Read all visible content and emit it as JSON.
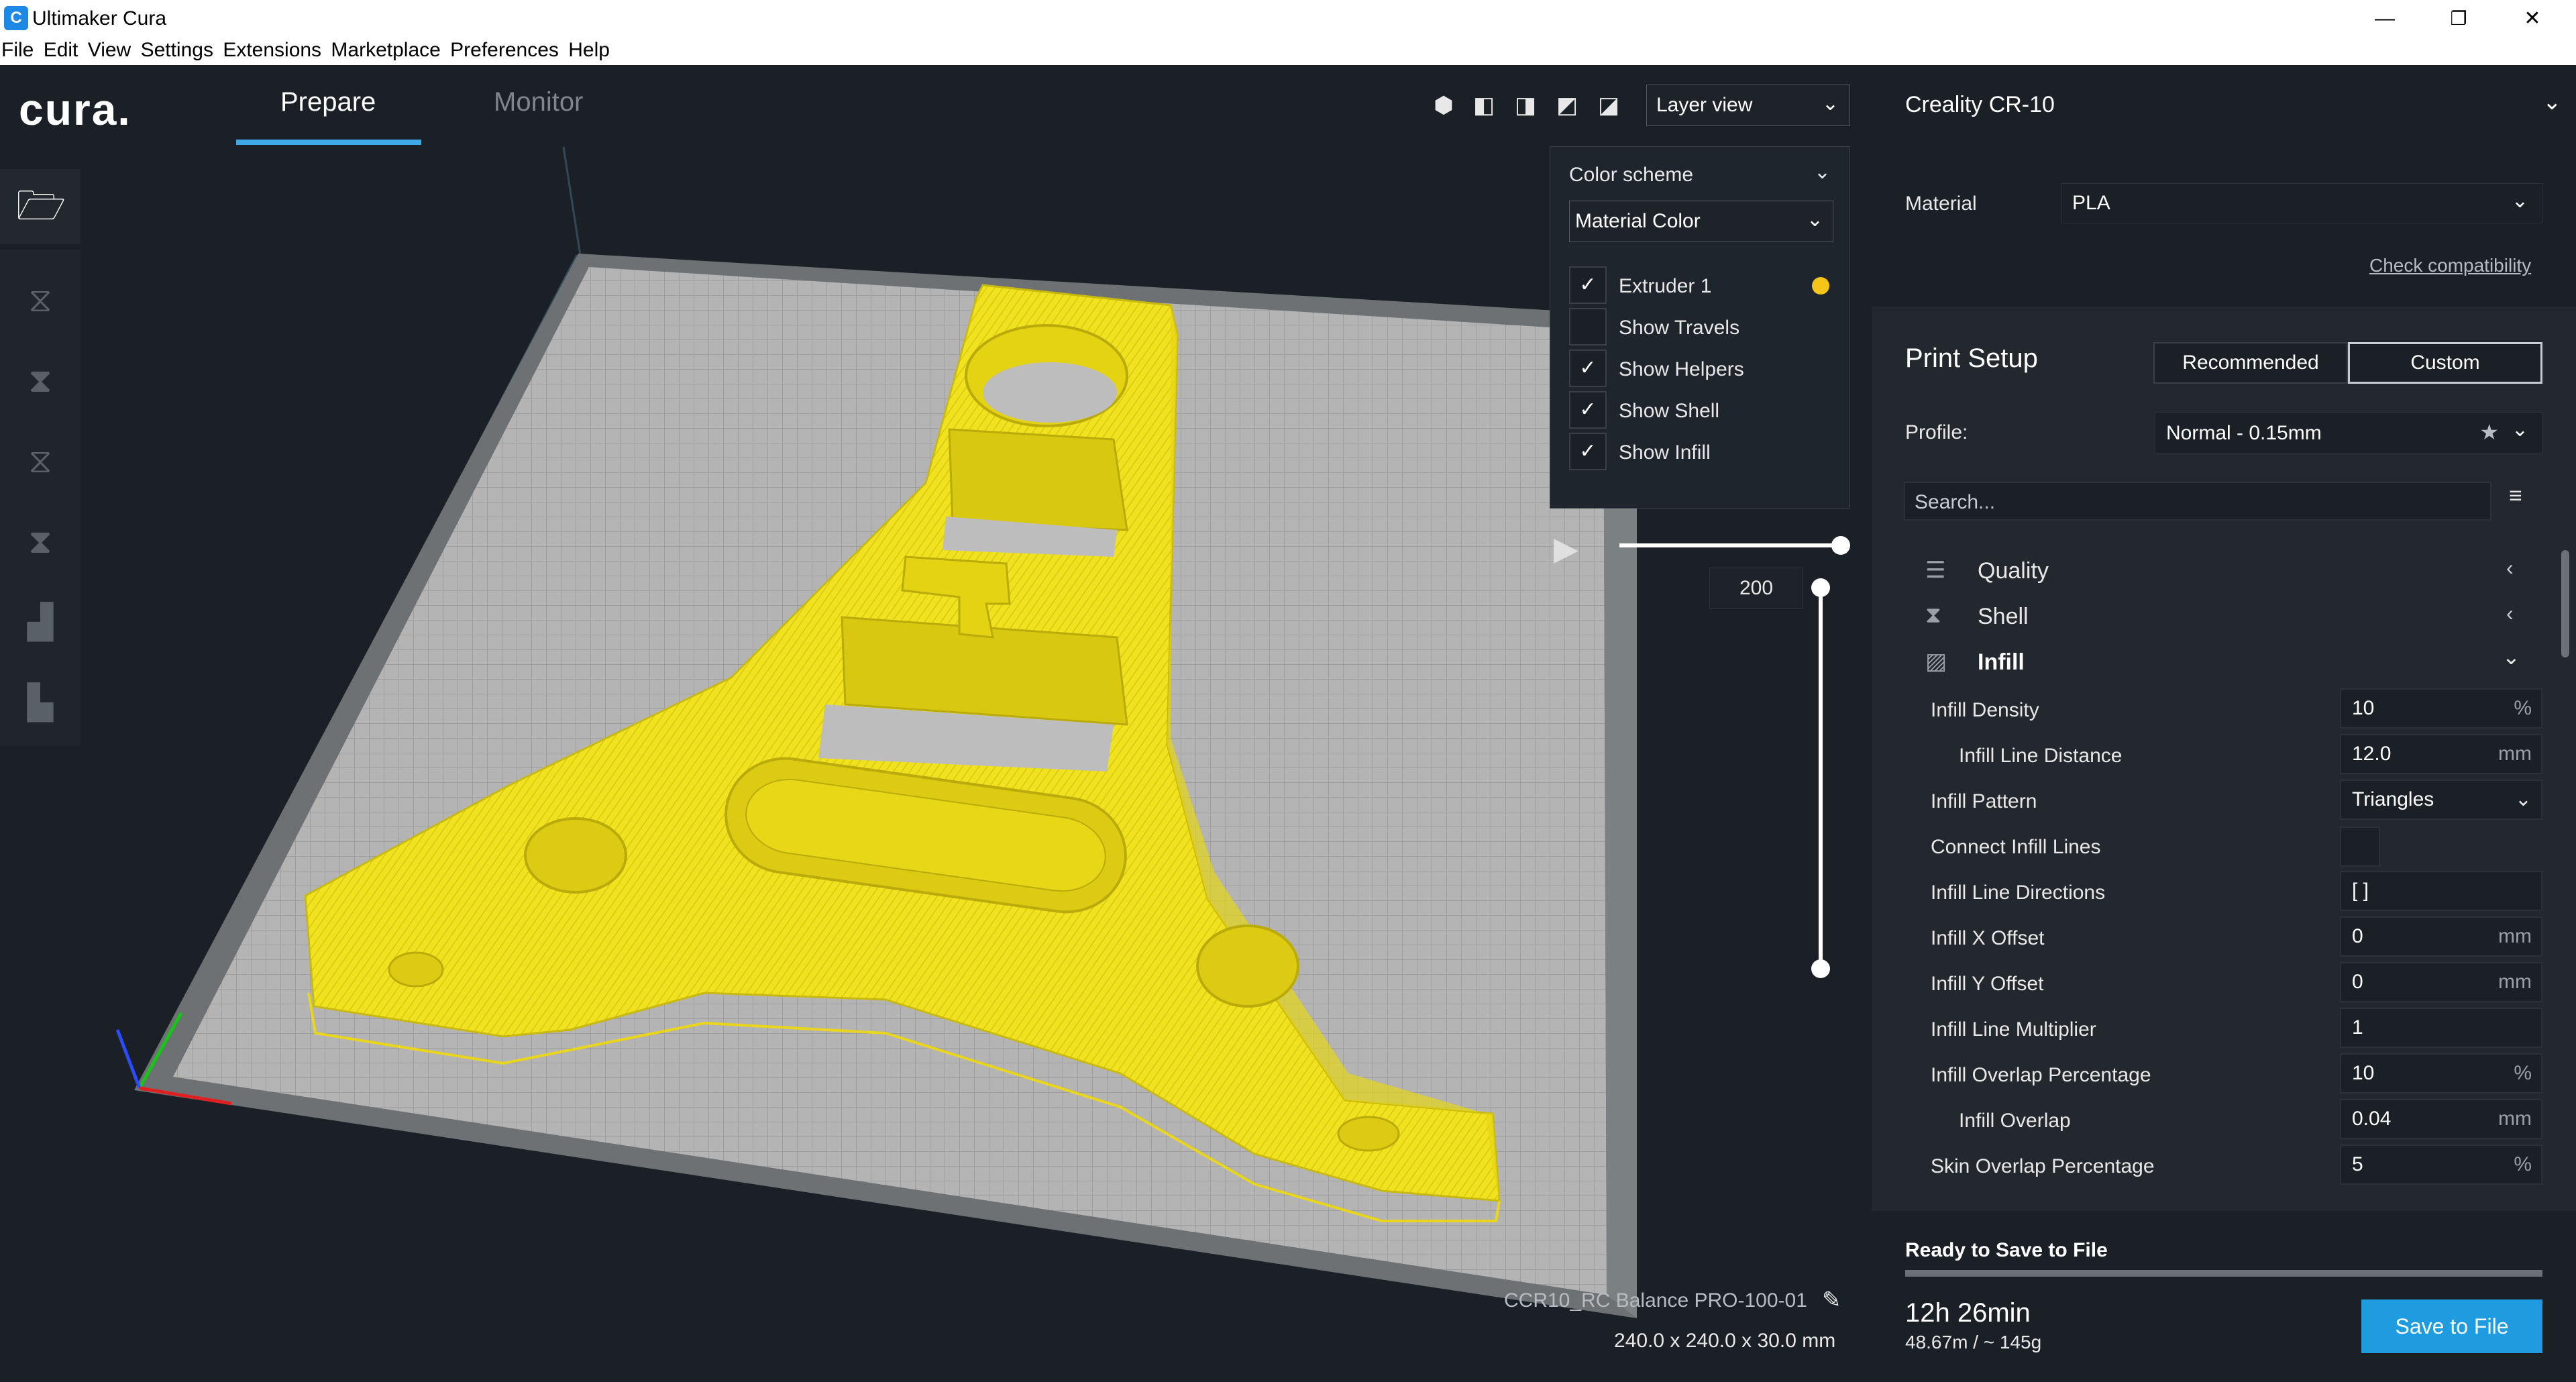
{
  "window": {
    "title": "Ultimaker Cura",
    "logo_letter": "C",
    "minimize": "—",
    "maximize": "❐",
    "close": "✕"
  },
  "menu": [
    "File",
    "Edit",
    "View",
    "Settings",
    "Extensions",
    "Marketplace",
    "Preferences",
    "Help"
  ],
  "header": {
    "brand": "cura.",
    "tabs": [
      "Prepare",
      "Monitor"
    ],
    "view_mode": "Layer view",
    "view_icons": [
      "3d-view-icon",
      "front-view-icon",
      "top-view-icon",
      "left-view-icon",
      "right-view-icon"
    ]
  },
  "layer_panel": {
    "color_scheme_label": "Color scheme",
    "color_scheme_value": "Material Color",
    "options": [
      {
        "label": "Extruder 1",
        "checked": true
      },
      {
        "label": "Show Travels",
        "checked": false
      },
      {
        "label": "Show Helpers",
        "checked": true
      },
      {
        "label": "Show Shell",
        "checked": true
      },
      {
        "label": "Show Infill",
        "checked": true
      }
    ],
    "extruder_color": "#f5c518",
    "layer_number": "200"
  },
  "model": {
    "name": "CCR10_RC Balance PRO-100-01",
    "dimensions": "240.0 x 240.0 x 30.0 mm",
    "color": "#f1e21f"
  },
  "printer": {
    "name": "Creality CR-10",
    "material_label": "Material",
    "material_value": "PLA",
    "check_link": "Check compatibility"
  },
  "print_setup": {
    "title": "Print Setup",
    "modes": [
      "Recommended",
      "Custom"
    ],
    "profile_label": "Profile:",
    "profile_value": "Normal - 0.15mm",
    "search_placeholder": "Search...",
    "categories": [
      {
        "label": "Quality"
      },
      {
        "label": "Shell"
      },
      {
        "label": "Infill"
      }
    ],
    "settings": [
      {
        "label": "Infill Density",
        "value": "10",
        "unit": "%",
        "indent": false
      },
      {
        "label": "Infill Line Distance",
        "value": "12.0",
        "unit": "mm",
        "indent": true
      },
      {
        "label": "Infill Pattern",
        "value": "Triangles",
        "unit": "",
        "indent": false,
        "dropdown": true
      },
      {
        "label": "Connect Infill Lines",
        "value": "",
        "unit": "",
        "indent": false,
        "checkbox": true
      },
      {
        "label": "Infill Line Directions",
        "value": "[ ]",
        "unit": "",
        "indent": false
      },
      {
        "label": "Infill X Offset",
        "value": "0",
        "unit": "mm",
        "indent": false
      },
      {
        "label": "Infill Y Offset",
        "value": "0",
        "unit": "mm",
        "indent": false
      },
      {
        "label": "Infill Line Multiplier",
        "value": "1",
        "unit": "",
        "indent": false
      },
      {
        "label": "Infill Overlap Percentage",
        "value": "10",
        "unit": "%",
        "indent": false
      },
      {
        "label": "Infill Overlap",
        "value": "0.04",
        "unit": "mm",
        "indent": true
      },
      {
        "label": "Skin Overlap Percentage",
        "value": "5",
        "unit": "%",
        "indent": false
      }
    ]
  },
  "footer": {
    "status": "Ready to Save to File",
    "time": "12h 26min",
    "usage": "48.67m / ~ 145g",
    "save_button": "Save to File"
  },
  "colors": {
    "accent": "#3fa9e8",
    "button": "#1f9be0",
    "bg": "#1b2027",
    "panel": "#23282e"
  }
}
